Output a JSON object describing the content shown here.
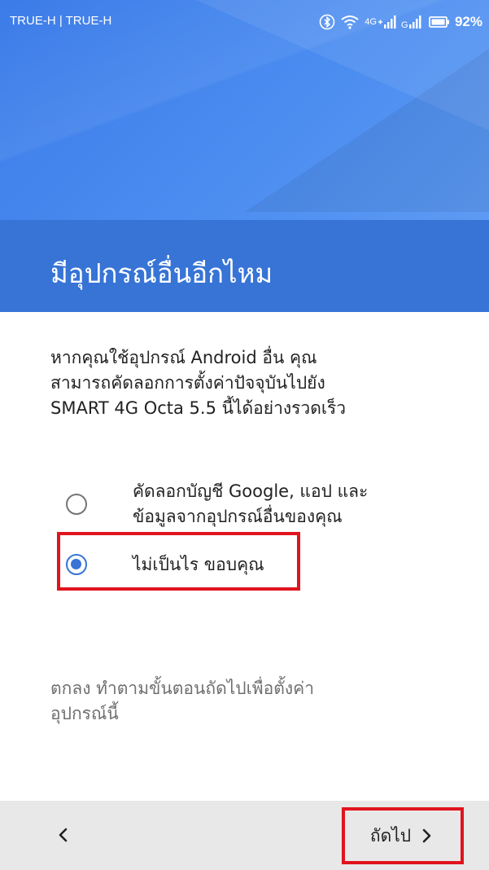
{
  "status_bar": {
    "carrier": "TRUE-H | TRUE-H",
    "network_type": "4G",
    "battery_percent": "92%",
    "icons": [
      "bluetooth-icon",
      "wifi-icon",
      "signal-4g-icon",
      "signal-g-icon",
      "battery-icon"
    ]
  },
  "header": {
    "title": "มีอุปกรณ์อื่นอีกไหม"
  },
  "description": {
    "lines": [
      "หากคุณใช้อุปกรณ์ Android อื่น คุณ",
      "สามารถคัดลอกการตั้งค่าปัจจุบันไปยัง",
      "SMART 4G Octa 5.5 นี้ได้อย่างรวดเร็ว"
    ]
  },
  "options": [
    {
      "lines": [
        "คัดลอกบัญชี Google, แอป และ",
        "ข้อมูลจากอุปกรณ์อื่นของคุณ"
      ],
      "selected": false
    },
    {
      "lines": [
        "ไม่เป็นไร ขอบคุณ"
      ],
      "selected": true
    }
  ],
  "note": {
    "lines": [
      "ตกลง ทำตามขั้นตอนถัดไปเพื่อตั้งค่า",
      "อุปกรณ์นี้"
    ]
  },
  "bottom_nav": {
    "next_label": "ถัดไป"
  },
  "colors": {
    "accent": "#3774d6",
    "banner": "#4a8cf0",
    "highlight": "#e0141e",
    "nav_background": "#e8e8e8"
  }
}
